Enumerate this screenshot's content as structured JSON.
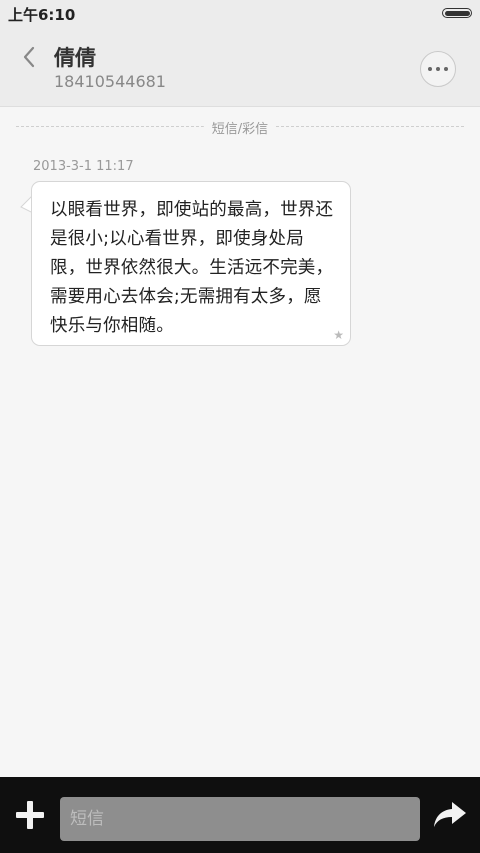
{
  "status_bar": {
    "time": "上午6:10",
    "battery_icon": "battery-full-icon"
  },
  "header": {
    "back_icon": "chevron-left-icon",
    "contact_name": "倩倩",
    "contact_number": "18410544681",
    "more_icon": "more-dots-icon"
  },
  "conversation": {
    "divider_label": "短信/彩信",
    "messages": [
      {
        "timestamp": "2013-3-1 11:17",
        "text": "以眼看世界，即使站的最高，世界还是很小;以心看世界，即使身处局限，世界依然很大。生活远不完美，需要用心去体会;无需拥有太多，愿快乐与你相随。",
        "star_icon": "star-icon",
        "star_glyph": "★"
      }
    ]
  },
  "composer": {
    "add_icon": "plus-icon",
    "input_value": "",
    "input_placeholder": "短信",
    "send_icon": "send-arrow-icon"
  },
  "colors": {
    "background": "#f6f6f6",
    "header": "#ececec",
    "bubble": "#ffffff",
    "bottom_bar": "#0f0f0f",
    "input": "#8e8e8e"
  }
}
